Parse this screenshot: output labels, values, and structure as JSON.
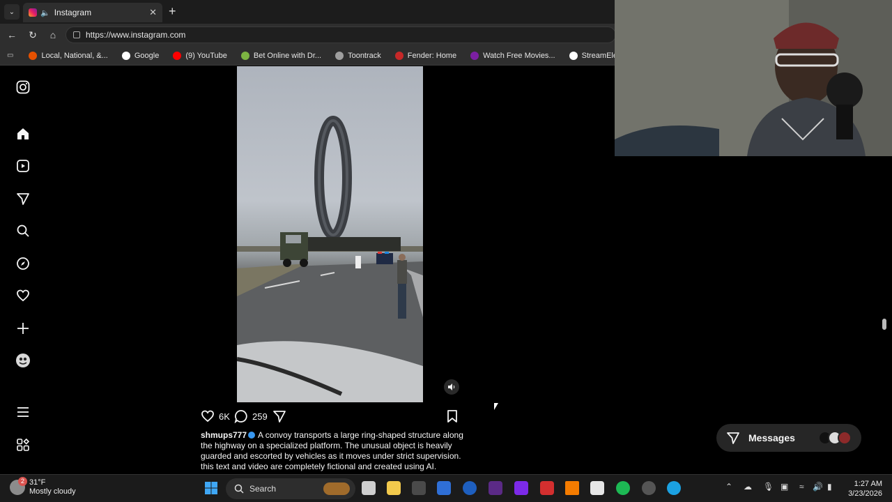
{
  "browser": {
    "tab_title": "Instagram",
    "url": "https://www.instagram.com",
    "bookmarks": [
      {
        "label": "Local, National, &...",
        "color": "#e65100"
      },
      {
        "label": "Google",
        "color": "#4285f4"
      },
      {
        "label": "(9) YouTube",
        "color": "#ff0000"
      },
      {
        "label": "Bet Online with Dr...",
        "color": "#7cb342"
      },
      {
        "label": "Toontrack",
        "color": "#9e9e9e"
      },
      {
        "label": "Fender: Home",
        "color": "#c62828"
      },
      {
        "label": "Watch Free Movies...",
        "color": "#7b1fa2"
      },
      {
        "label": "StreamElements | T...",
        "color": "#ffffff"
      }
    ]
  },
  "post": {
    "likes": "6K",
    "comments": "259",
    "username": "shmups777",
    "caption": "A convoy transports a large ring-shaped structure along the highway on a specialized platform. The unusual object is heavily guarded and escorted by vehicles as it moves under strict supervision. this text and video are completely fictional and created using AI."
  },
  "messages": {
    "label": "Messages"
  },
  "taskbar": {
    "temperature": "31°F",
    "weather": "Mostly cloudy",
    "weather_badge": "2",
    "search_label": "Search",
    "time": "1:27 AM",
    "date": "3/23/2026"
  }
}
